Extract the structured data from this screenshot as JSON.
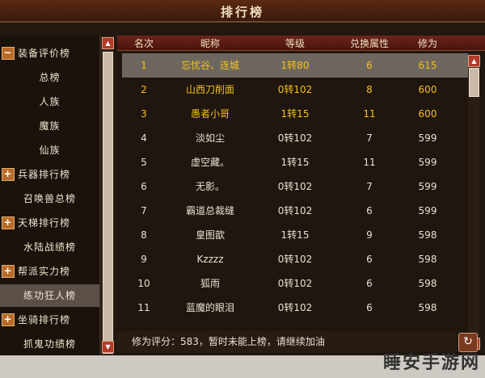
{
  "window": {
    "title": "排行榜"
  },
  "tree": [
    {
      "kind": "cat",
      "label": "装备评价榜",
      "expanded": true
    },
    {
      "kind": "sub",
      "label": "总榜"
    },
    {
      "kind": "sub",
      "label": "人族"
    },
    {
      "kind": "sub",
      "label": "魔族"
    },
    {
      "kind": "sub",
      "label": "仙族"
    },
    {
      "kind": "cat",
      "label": "兵器排行榜",
      "expanded": false
    },
    {
      "kind": "sub",
      "label": "召唤兽总榜"
    },
    {
      "kind": "cat",
      "label": "天梯排行榜",
      "expanded": false
    },
    {
      "kind": "sub",
      "label": "水陆战绩榜"
    },
    {
      "kind": "cat",
      "label": "帮派实力榜",
      "expanded": false
    },
    {
      "kind": "sub",
      "label": "练功狂人榜",
      "selected": true
    },
    {
      "kind": "cat",
      "label": "坐骑排行榜",
      "expanded": false
    },
    {
      "kind": "sub",
      "label": "抓鬼功绩榜"
    }
  ],
  "columns": [
    "名次",
    "昵称",
    "等级",
    "兑换属性",
    "修为"
  ],
  "rows": [
    {
      "rank": "1",
      "name": "忘忧谷、连城",
      "level": "1转80",
      "attr": "6",
      "xiuwei": "615",
      "gold": true,
      "selected": true
    },
    {
      "rank": "2",
      "name": "山西刀削面",
      "level": "0转102",
      "attr": "8",
      "xiuwei": "600",
      "gold": true
    },
    {
      "rank": "3",
      "name": "愚者小哥",
      "level": "1转15",
      "attr": "11",
      "xiuwei": "600",
      "gold": true
    },
    {
      "rank": "4",
      "name": "淡如尘",
      "level": "0转102",
      "attr": "7",
      "xiuwei": "599"
    },
    {
      "rank": "5",
      "name": "虚空藏。",
      "level": "1转15",
      "attr": "11",
      "xiuwei": "599"
    },
    {
      "rank": "6",
      "name": "无影。",
      "level": "0转102",
      "attr": "7",
      "xiuwei": "599"
    },
    {
      "rank": "7",
      "name": "霸道总裁缝",
      "level": "0转102",
      "attr": "6",
      "xiuwei": "599"
    },
    {
      "rank": "8",
      "name": "皇图歆",
      "level": "1转15",
      "attr": "9",
      "xiuwei": "598"
    },
    {
      "rank": "9",
      "name": "Kzzzz",
      "level": "0转102",
      "attr": "6",
      "xiuwei": "598"
    },
    {
      "rank": "10",
      "name": "狐雨",
      "level": "0转102",
      "attr": "6",
      "xiuwei": "598"
    },
    {
      "rank": "11",
      "name": "蓝魔的眼泪",
      "level": "0转102",
      "attr": "6",
      "xiuwei": "598"
    }
  ],
  "status": {
    "text": "修为评分：583，暂时未能上榜，请继续加油"
  },
  "icons": {
    "expand": "+",
    "collapse": "−",
    "refresh": "↻"
  },
  "watermark": "睡安手游网",
  "colors": {
    "gold": "#f4c21a",
    "header": "#5a1c14",
    "selected": "#6e6760"
  }
}
